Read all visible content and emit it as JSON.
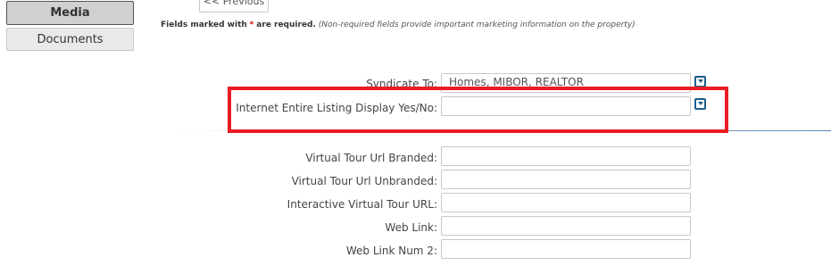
{
  "sidebar": {
    "tabs": [
      {
        "label": "Media",
        "active": true
      },
      {
        "label": "Documents",
        "active": false
      }
    ]
  },
  "nav": {
    "previous_label": "<< Previous"
  },
  "notice": {
    "prefix": "Fields marked with",
    "required_marker": "*",
    "suffix": "are required.",
    "note": "(Non-required fields provide important marketing information on the property)"
  },
  "form": {
    "syndicate_to": {
      "label": "Syndicate To:",
      "value": "Homes, MIBOR, REALTOR"
    },
    "internet_display": {
      "label": "Internet Entire Listing Display Yes/No:",
      "value": ""
    },
    "links": [
      {
        "label": "Virtual Tour Url Branded:",
        "value": ""
      },
      {
        "label": "Virtual Tour Url Unbranded:",
        "value": ""
      },
      {
        "label": "Interactive Virtual Tour URL:",
        "value": ""
      },
      {
        "label": "Web Link:",
        "value": ""
      },
      {
        "label": "Web Link Num 2:",
        "value": ""
      }
    ]
  },
  "colors": {
    "highlight_border": "#ec1c24",
    "dropdown_icon": "#1d5d8c",
    "required_star": "#d00000"
  }
}
